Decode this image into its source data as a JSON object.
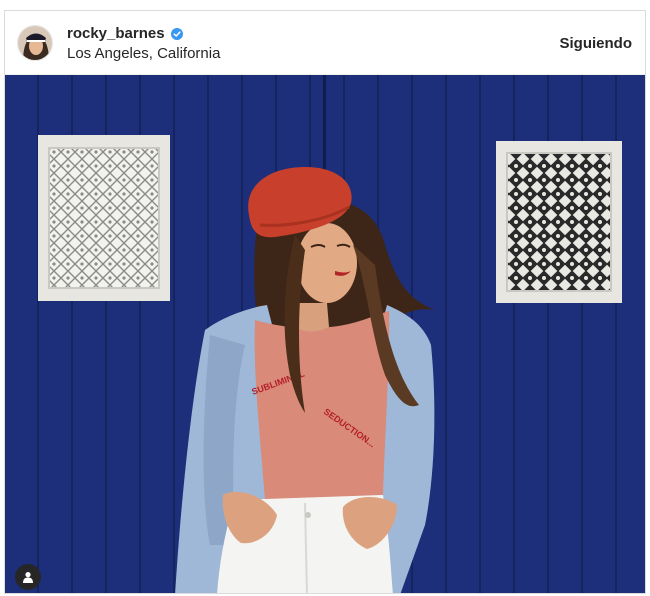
{
  "post": {
    "username": "rocky_barnes",
    "verified": true,
    "location": "Los Angeles, California",
    "follow_label": "Siguiendo"
  },
  "photo": {
    "subject": "woman in red beret and blue coat against blue wall",
    "shirt_text_line1": "SUBLIMINAL",
    "shirt_text_line2": "SEDUCTION..."
  },
  "colors": {
    "wall_blue": "#1d2f7a",
    "beret_red": "#c8402b",
    "shirt_pink": "#d98a78",
    "coat_blue": "#9fb8d8",
    "verified_blue": "#3897f0"
  },
  "icons": {
    "verified": "verified-badge-icon",
    "tagged_user": "user-tag-icon"
  }
}
